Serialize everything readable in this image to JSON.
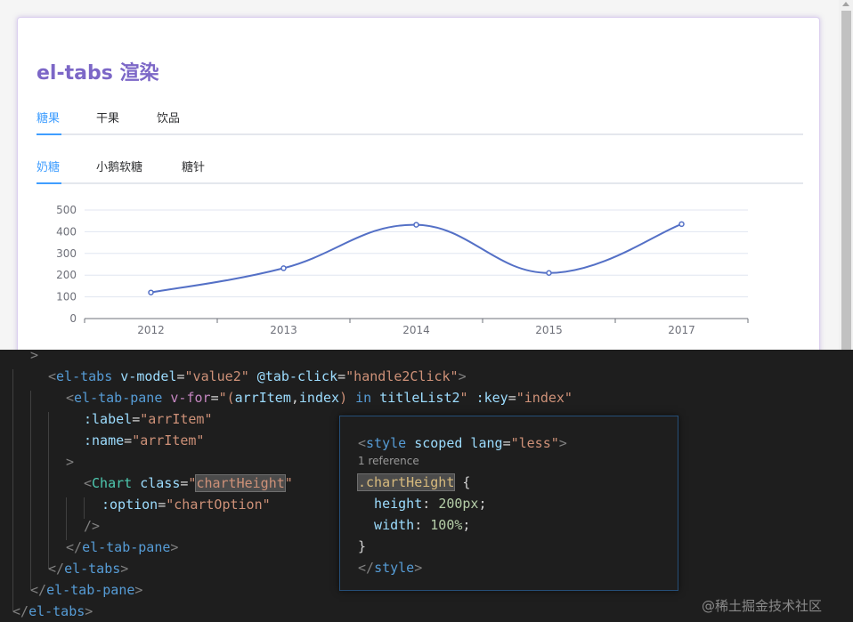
{
  "page": {
    "title": "el-tabs 渲染"
  },
  "tabs_level1": {
    "items": [
      "糖果",
      "干果",
      "饮品"
    ],
    "active": 0
  },
  "tabs_level2": {
    "items": [
      "奶糖",
      "小鹅软糖",
      "糖针"
    ],
    "active": 0
  },
  "chart_data": {
    "type": "line",
    "categories": [
      "2012",
      "2013",
      "2014",
      "2015",
      "2017"
    ],
    "series": [
      {
        "values": [
          120,
          232,
          432,
          210,
          435
        ]
      }
    ],
    "ylim": [
      0,
      500
    ],
    "yticks": [
      0,
      100,
      200,
      300,
      400,
      500
    ],
    "smooth": true,
    "grid": true,
    "line_color": "#5470c6"
  },
  "editor": {
    "lines": [
      [
        [
          "pn",
          ">"
        ]
      ],
      [
        [
          "pn",
          "<"
        ],
        [
          "tg",
          "el-tabs"
        ],
        [
          "at",
          " v-model"
        ],
        [
          "",
          "="
        ],
        [
          "st",
          "\"value2\""
        ],
        [
          "at",
          " @tab-click"
        ],
        [
          "",
          "="
        ],
        [
          "st",
          "\"handle2Click\""
        ],
        [
          "pn",
          ">"
        ]
      ],
      [
        [
          "pn",
          "<"
        ],
        [
          "tg",
          "el-tab-pane"
        ],
        [
          "df",
          " v-for"
        ],
        [
          "",
          "="
        ],
        [
          "st",
          "\"("
        ],
        [
          "at",
          "arrItem"
        ],
        [
          "",
          ","
        ],
        [
          "at",
          "index"
        ],
        [
          "st",
          ")"
        ],
        [
          "kw",
          " in "
        ],
        [
          "at",
          "titleList2"
        ],
        [
          "st",
          "\""
        ],
        [
          "at",
          " :key"
        ],
        [
          "",
          "="
        ],
        [
          "st",
          "\"index\""
        ]
      ],
      [
        [
          "at",
          ":label"
        ],
        [
          "",
          "="
        ],
        [
          "st",
          "\"arrItem\""
        ]
      ],
      [
        [
          "at",
          ":name"
        ],
        [
          "",
          "="
        ],
        [
          "st",
          "\"arrItem\""
        ]
      ],
      [
        [
          "pn",
          ">"
        ]
      ],
      [
        [
          "pn",
          "<"
        ],
        [
          "cm",
          "Chart"
        ],
        [
          "at",
          " class"
        ],
        [
          "",
          "="
        ],
        [
          "st",
          "\""
        ],
        [
          "st hl",
          "chartHeight"
        ],
        [
          "st",
          "\""
        ]
      ],
      [
        [
          "at",
          ":option"
        ],
        [
          "",
          "="
        ],
        [
          "st",
          "\"chartOption\""
        ]
      ],
      [
        [
          "pn",
          "/>"
        ]
      ],
      [
        [
          "pn",
          "</"
        ],
        [
          "tg",
          "el-tab-pane"
        ],
        [
          "pn",
          ">"
        ]
      ],
      [
        [
          "pn",
          "</"
        ],
        [
          "tg",
          "el-tabs"
        ],
        [
          "pn",
          ">"
        ]
      ],
      [
        [
          "pn",
          "</"
        ],
        [
          "tg",
          "el-tab-pane"
        ],
        [
          "pn",
          ">"
        ]
      ],
      [
        [
          "pn",
          "</"
        ],
        [
          "tg",
          "el-tabs"
        ],
        [
          "pn",
          ">"
        ]
      ]
    ]
  },
  "peek": {
    "lines": [
      [
        [
          "pn",
          "<"
        ],
        [
          "tg",
          "style"
        ],
        [
          "at",
          " scoped"
        ],
        [
          "at",
          " lang"
        ],
        [
          "",
          "="
        ],
        [
          "st",
          "\"less\""
        ],
        [
          "pn",
          ">"
        ]
      ],
      [
        [
          "ref",
          "1 reference"
        ]
      ],
      [
        [
          "sel hl",
          ".chartHeight"
        ],
        [
          "",
          " {"
        ]
      ],
      [
        [
          "pr",
          "  height"
        ],
        [
          "",
          ": "
        ],
        [
          "nm",
          "200px"
        ],
        [
          "",
          ";"
        ]
      ],
      [
        [
          "pr",
          "  width"
        ],
        [
          "",
          ": "
        ],
        [
          "nm",
          "100%"
        ],
        [
          "",
          ";"
        ]
      ],
      [
        [
          "",
          "}"
        ]
      ],
      [
        [
          "pn",
          "</"
        ],
        [
          "tg",
          "style"
        ],
        [
          "pn",
          ">"
        ]
      ]
    ]
  },
  "watermark": "@稀土掘金技术社区"
}
